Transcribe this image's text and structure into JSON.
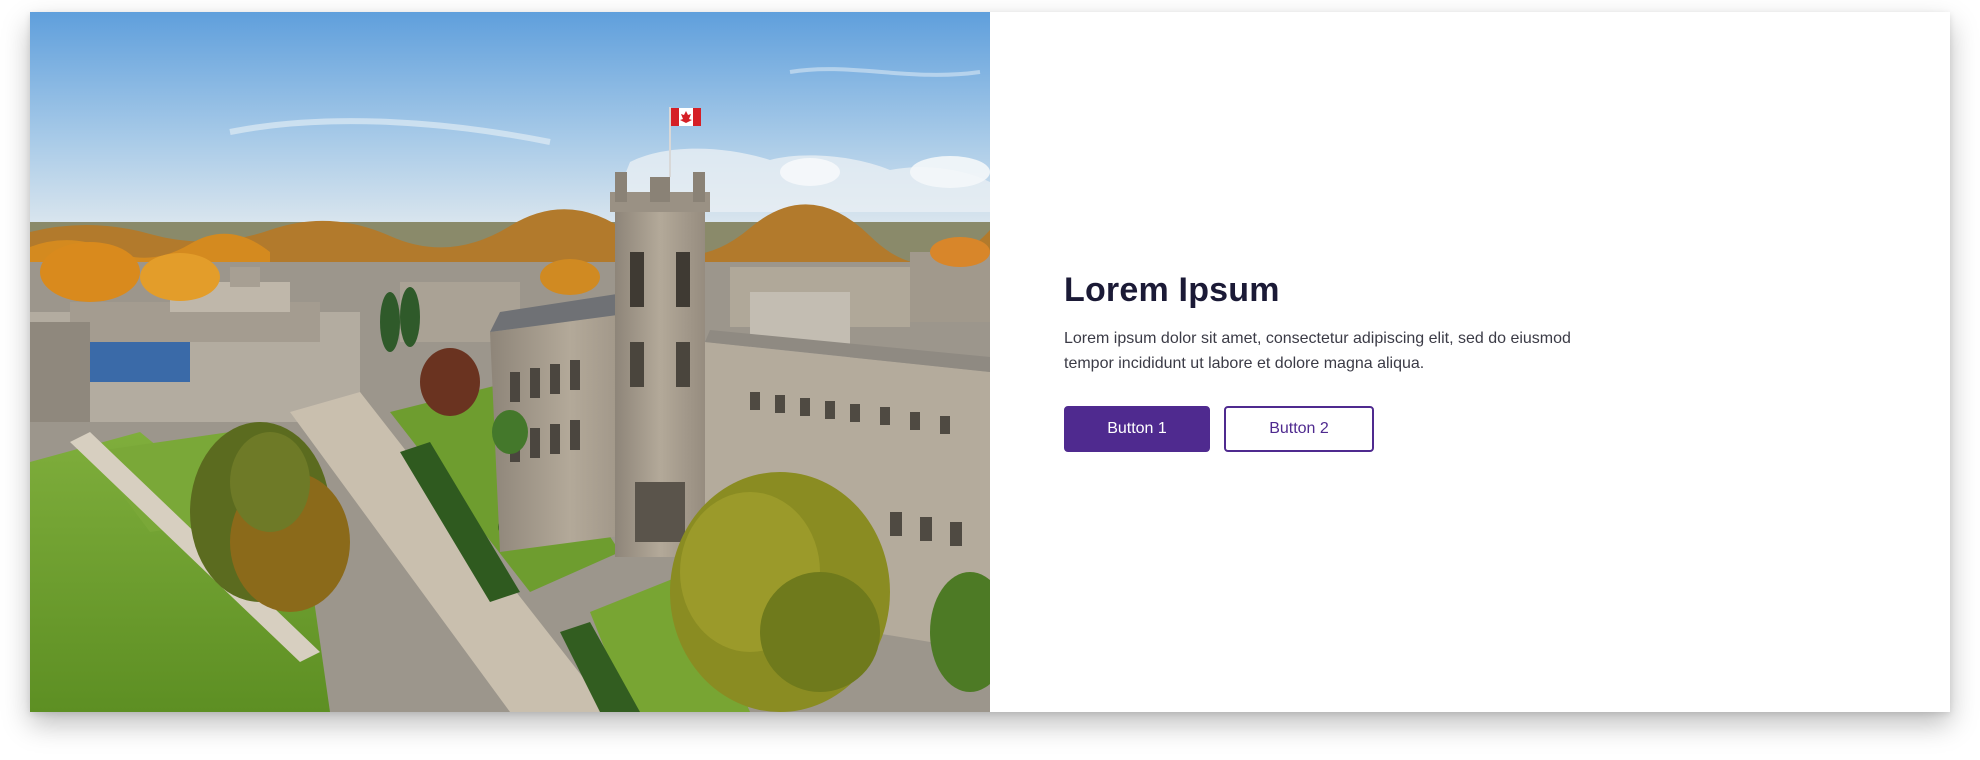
{
  "hero": {
    "image_alt": "Aerial view of a university campus with a stone clock tower and a Canadian flag in autumn",
    "title": "Lorem Ipsum",
    "body": "Lorem ipsum dolor sit amet, consectetur adipiscing elit, sed do eiusmod tempor incididunt ut labore et dolore magna aliqua.",
    "primary_button": "Button 1",
    "secondary_button": "Button 2"
  },
  "colors": {
    "accent": "#4f2a8f",
    "title": "#1b1a36",
    "body": "#3b3b46",
    "background": "#ffffff"
  },
  "icons": {
    "flag": "canada-flag-icon"
  }
}
